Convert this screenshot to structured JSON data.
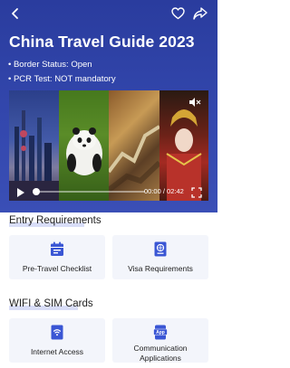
{
  "header": {
    "title": "China Travel Guide 2023",
    "status_lines": [
      "• Border Status: Open",
      "• PCR Test: NOT mandatory"
    ]
  },
  "video": {
    "time_display": "00:00 / 02:42",
    "progress": 0.0
  },
  "sections": [
    {
      "title": "Entry Requirements",
      "cards": [
        {
          "label": "Pre-Travel Checklist",
          "icon": "calendar-icon"
        },
        {
          "label": "Visa Requirements",
          "icon": "passport-icon"
        }
      ]
    },
    {
      "title": "WIFI & SIM Cards",
      "cards": [
        {
          "label": "Internet Access",
          "icon": "wifi-icon"
        },
        {
          "label": "Communication Applications",
          "icon": "app-icon"
        }
      ]
    }
  ],
  "colors": {
    "hero": "#3347ad",
    "accent": "#3a56d4",
    "card_bg": "#f3f5fb"
  }
}
